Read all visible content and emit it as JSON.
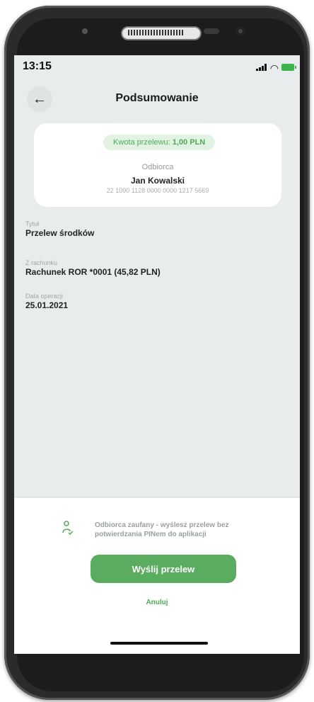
{
  "status_bar": {
    "time": "13:15"
  },
  "header": {
    "title": "Podsumowanie"
  },
  "summary_card": {
    "amount_label": "Kwota przelewu: ",
    "amount_value": "1,00 PLN",
    "recipient_label": "Odbiorca",
    "recipient_name": "Jan Kowalski",
    "account_number": "22 1090 1128 0000 0000 1217 5669"
  },
  "fields": [
    {
      "label": "Tytuł",
      "value": "Przelew środków"
    },
    {
      "label": "Z rachunku",
      "value": "Rachunek ROR *0001 (45,82 PLN)"
    },
    {
      "label": "Data operacji",
      "value": "25.01.2021"
    }
  ],
  "footer": {
    "trusted_note": "Odbiorca zaufany - wyślesz przelew bez potwierdzania PINem do aplikacji",
    "send_button": "Wyślij przelew",
    "cancel_link": "Anuluj"
  },
  "colors": {
    "accent": "#5aac5e",
    "background": "#e9ecec"
  },
  "icons": {
    "back": "arrow-left-icon",
    "trusted": "trusted-recipient-icon"
  }
}
